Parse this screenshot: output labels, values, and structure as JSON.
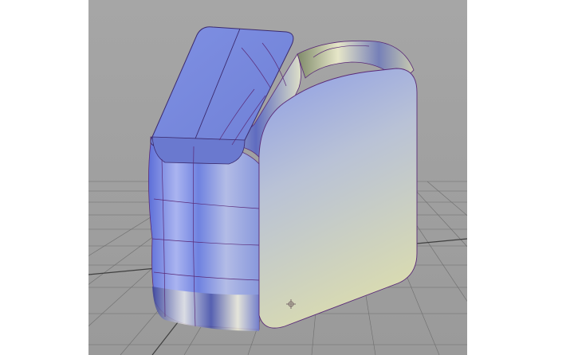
{
  "viewport": {
    "background": "#9f9f9f",
    "grid_color": "#6e6e6e",
    "grid_major_color": "#3f3f3f"
  },
  "model": {
    "surface_blue": "#7d8fe6",
    "surface_cream": "#d6d9b8",
    "isoparm_color": "#5a2a78",
    "pivot_icon": "manipulator-icon"
  }
}
